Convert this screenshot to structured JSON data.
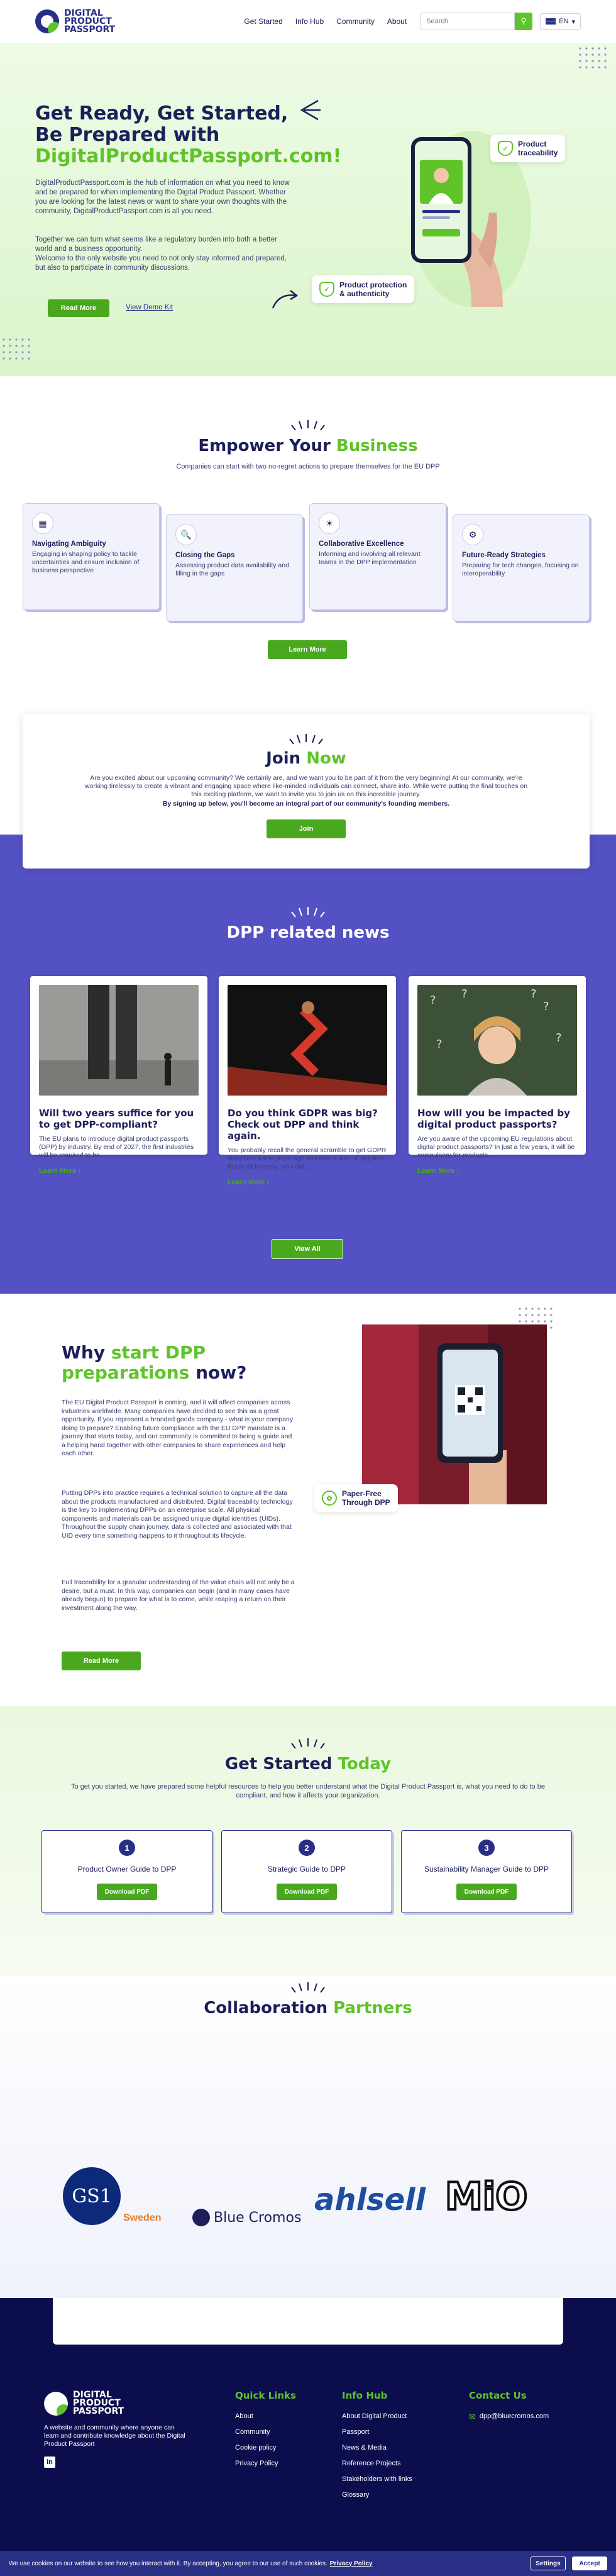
{
  "header": {
    "logo_line1": "DIGITAL",
    "logo_line2": "PRODUCT",
    "logo_line3": "PASSPORT",
    "nav": [
      "Get Started",
      "Info Hub",
      "Community",
      "About"
    ],
    "search_placeholder": "Search",
    "language": "EN"
  },
  "hero": {
    "title_line1": "Get Ready, Get Started,",
    "title_line2": "Be Prepared with",
    "title_highlight": "DigitalProductPassport.com!",
    "para1": "DigitalProductPassport.com is the hub of information on what you need to know and be prepared for when implementing the Digital Product Passport. Whether you are looking for the latest news or want to share your own thoughts with the community, DigitalProductPassport.com is all you need.",
    "para2": "Together we can turn what seems like a regulatory burden into both a better world and a business opportunity.",
    "para3": "Welcome to the only website you need to not only stay informed and prepared, but also to participate in community discussions.",
    "read_more": "Read More",
    "view_demo": "View Demo Kit",
    "badge_traceability_1": "Product",
    "badge_traceability_2": "traceability",
    "badge_protection_1": "Product protection",
    "badge_protection_2": "& authenticity"
  },
  "empower": {
    "title": "Empower Your",
    "title_highlight": "Business",
    "subtitle": "Companies can start with two no-regret actions to prepare themselves for the EU DPP",
    "cards": [
      {
        "title": "Navigating Ambiguity",
        "text": "Engaging in shaping policy to tackle uncertainties and ensure inclusion of business perspective"
      },
      {
        "title": "Closing the Gaps",
        "text": "Assessing product data availability and filling in the gaps"
      },
      {
        "title": "Collaborative Excellence",
        "text": "Informing and involving all relevant teams in the DPP implementation"
      },
      {
        "title": "Future-Ready Strategies",
        "text": "Preparing for tech changes, focusing on interoperability"
      }
    ],
    "learn_more": "Learn More"
  },
  "join": {
    "title": "Join",
    "title_highlight": "Now",
    "text": "Are you excited about our upcoming community? We certainly are, and we want you to be part of it from the very beginning! At our community, we're working tirelessly to create a vibrant and engaging space where like-minded individuals can connect, share info. While we're putting the final touches on this exciting platform, we want to invite you to join us on this incredible journey.",
    "bold": "By signing up below, you'll become an integral part of our community's founding members.",
    "button": "Join"
  },
  "news": {
    "title": "DPP related news",
    "items": [
      {
        "title": "Will two years suffice for you to get DPP-compliant?",
        "text": "The EU plans to introduce digital product passports (DPP) by industry. By end of 2027, the first industries will be required to be...",
        "link": "Learn More"
      },
      {
        "title": "Do you think GDPR was big? Check out DPP and think again.",
        "text": "You probably recall the general scramble to get GDPR compliant a few years ago and then it was all big deal. But in all honesty, who did...",
        "link": "Learn More"
      },
      {
        "title": "How will you be impacted by digital product passports?",
        "text": "Are you aware of the upcoming EU regulations about digital product passports? In just a few years, it will be compulsory for products...",
        "link": "Learn More"
      }
    ],
    "view_all": "View All"
  },
  "why": {
    "title_a": "Why",
    "title_hl": "start DPP preparations",
    "title_b": "now?",
    "p1": "The EU Digital Product Passport is coming, and it will affect companies across industries worldwide. Many companies have decided to see this as a great opportunity. If you represent a branded goods company - what is your company doing to prepare? Enabling future compliance with the EU DPP mandate is a journey that starts today, and our community is committed to being a guide and a helping hand together with other companies to share experiences and help each other.",
    "p2": "Putting DPPs into practice requires a technical solution to capture all the data about the products manufactured and distributed. Digital traceability technology is the key to implementing DPPs on an enterprise scale. All physical components and materials can be assigned unique digital identities (UIDs). Throughout the supply chain journey, data is collected and associated with that UID every time something happens to it throughout its lifecycle.",
    "p3": "Full traceability for a granular understanding of the value chain will not only be a desire, but a must. In this way, companies can begin (and in many cases have already begun) to prepare for what is to come, while reaping a return on their investment along the way.",
    "button": "Read More",
    "badge_1": "Paper-Free",
    "badge_2": "Through DPP"
  },
  "get_started": {
    "title": "Get Started",
    "title_highlight": "Today",
    "subtitle": "To get you started, we have prepared some helpful resources to help you better understand what the Digital Product Passport is, what you need to do to be compliant, and how it affects your organization.",
    "guides": [
      {
        "num": "1",
        "title": "Product Owner Guide to DPP",
        "button": "Download PDF"
      },
      {
        "num": "2",
        "title": "Strategic Guide to DPP",
        "button": "Download PDF"
      },
      {
        "num": "3",
        "title": "Sustainability Manager Guide to DPP",
        "button": "Download PDF"
      }
    ]
  },
  "partners": {
    "title": "Collaboration",
    "title_highlight": "Partners",
    "gs1": "GS1",
    "gs1_sub": "Sweden",
    "bluecromos": "Blue Cromos",
    "ahlsell": "ahlsell",
    "mio": "MiO"
  },
  "footer": {
    "desc": "A website and community where anyone can learn and contribute knowledge about the Digital Product Passport",
    "quick_title": "Quick Links",
    "quick": [
      "About",
      "Community",
      "Cookie policy",
      "Privacy Policy"
    ],
    "info_title": "Info Hub",
    "info": [
      "About Digital Product",
      "Passport",
      "News & Media",
      "Reference Projects",
      "Stakeholders with links",
      "Glossary"
    ],
    "contact_title": "Contact Us",
    "email": "dpp@bluecromos.com"
  },
  "cookie": {
    "text": "We use cookies on our website to see how you interact with it. By accepting, you agree to our use of such cookies.",
    "link": "Privacy Policy",
    "settings": "Settings",
    "accept": "Accept"
  }
}
